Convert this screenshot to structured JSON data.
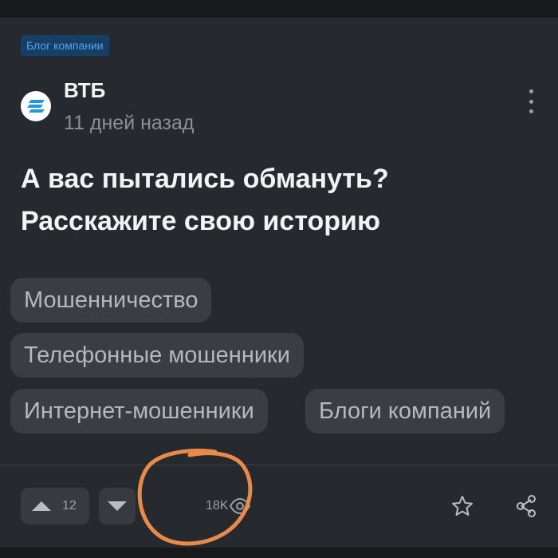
{
  "post": {
    "badge": "Блог компании",
    "author": "ВТБ",
    "time": "11 дней назад",
    "title_line1": "А вас пытались обмануть?",
    "title_line2": "Расскажите свою историю",
    "tags": [
      "Мошенничество",
      "Телефонные мошенники",
      "Интернет-мошенники",
      "Блоги компаний"
    ]
  },
  "footer": {
    "upvotes": "12",
    "views": "18K"
  },
  "icons": {
    "avatar": "vtb-logo-icon",
    "more": "more-vertical-icon",
    "upvote": "triangle-up-icon",
    "downvote": "triangle-down-icon",
    "views": "eye-icon",
    "save": "star-icon",
    "share": "share-icon"
  },
  "colors": {
    "background": "#26292e",
    "badge_bg": "#153f66",
    "badge_text": "#5aa3e3",
    "tag_bg": "#3a3d42",
    "annotation": "#e98a4a",
    "logo": "#1e9bd7"
  }
}
